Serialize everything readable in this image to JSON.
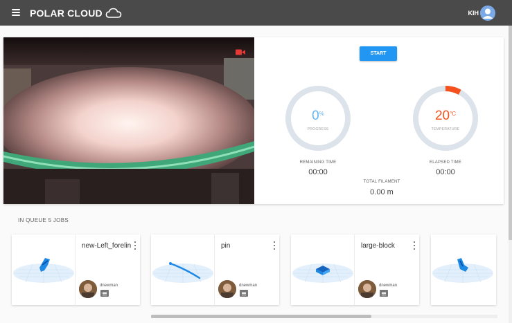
{
  "header": {
    "brand": "POLAR CLOUD",
    "user_initials": "KIH"
  },
  "printer": {
    "start_label": "START",
    "progress": {
      "value": "0",
      "unit": "%",
      "label": "PROGRESS",
      "fraction": 0
    },
    "temperature": {
      "value": "20",
      "unit": "°C",
      "label": "TEMPERATURE",
      "fraction": 0.08
    },
    "remaining_time": {
      "label": "REMAINING TIME",
      "value": "00:00"
    },
    "elapsed_time": {
      "label": "ELAPSED TIME",
      "value": "00:00"
    },
    "total_filament": {
      "label": "TOTAL FILAMENT",
      "value": "0.00 m"
    }
  },
  "colors": {
    "accent": "#2196f3",
    "progress_value": "#64b5f6",
    "temperature_value": "#f4511e",
    "temperature_arc": "#f4511e",
    "gauge_track": "#dde3ea",
    "topbar": "#4a4a4a"
  },
  "queue": {
    "title": "IN QUEUE 5 JOBS",
    "jobs": [
      {
        "name": "new-Left_forelin",
        "user": "dnewman",
        "model": "left-foreleg"
      },
      {
        "name": "pin",
        "user": "dnewman",
        "model": "pin"
      },
      {
        "name": "large-block",
        "user": "dnewman",
        "model": "block"
      },
      {
        "name": "",
        "user": "",
        "model": "foreleg-partial"
      }
    ]
  },
  "icons": {
    "menu": "hamburger-icon",
    "brand": "cloud-icon",
    "camera": "record-video-icon",
    "job_menu": "more-vert-icon",
    "comment": "comment-icon"
  }
}
